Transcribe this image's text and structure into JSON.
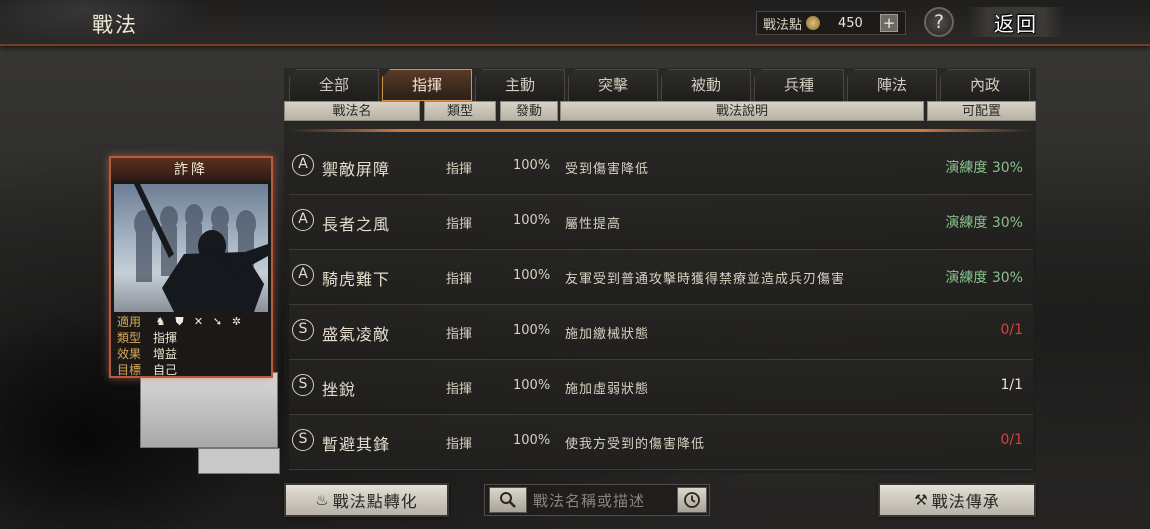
{
  "header": {
    "title": "戰法",
    "points_label": "戰法點",
    "points_value": "450",
    "add_label": "+",
    "help_label": "?",
    "back_label": "返回"
  },
  "tabs": [
    {
      "label": "全部",
      "active": false
    },
    {
      "label": "指揮",
      "active": true
    },
    {
      "label": "主動",
      "active": false
    },
    {
      "label": "突擊",
      "active": false
    },
    {
      "label": "被動",
      "active": false
    },
    {
      "label": "兵種",
      "active": false
    },
    {
      "label": "陣法",
      "active": false
    },
    {
      "label": "內政",
      "active": false
    }
  ],
  "columns": {
    "name": "戰法名",
    "type": "類型",
    "rate": "發動",
    "desc": "戰法說明",
    "config": "可配置"
  },
  "rows": [
    {
      "grade": "A",
      "name": "禦敵屏障",
      "type": "指揮",
      "rate": "100%",
      "desc": "受到傷害降低",
      "config": "演練度 30%",
      "config_status": "green"
    },
    {
      "grade": "A",
      "name": "長者之風",
      "type": "指揮",
      "rate": "100%",
      "desc": "屬性提高",
      "config": "演練度 30%",
      "config_status": "green"
    },
    {
      "grade": "A",
      "name": "騎虎難下",
      "type": "指揮",
      "rate": "100%",
      "desc": "友軍受到普通攻擊時獲得禁療並造成兵刃傷害",
      "config": "演練度 30%",
      "config_status": "green"
    },
    {
      "grade": "S",
      "name": "盛氣凌敵",
      "type": "指揮",
      "rate": "100%",
      "desc": "施加繳械狀態",
      "config": "0/1",
      "config_status": "red"
    },
    {
      "grade": "S",
      "name": "挫銳",
      "type": "指揮",
      "rate": "100%",
      "desc": "施加虛弱狀態",
      "config": "1/1",
      "config_status": "white"
    },
    {
      "grade": "S",
      "name": "暫避其鋒",
      "type": "指揮",
      "rate": "100%",
      "desc": "使我方受到的傷害降低",
      "config": "0/1",
      "config_status": "red"
    }
  ],
  "card": {
    "title": "詐降",
    "applies_label": "適用",
    "type_label": "類型",
    "type_value": "指揮",
    "effect_label": "效果",
    "effect_value": "增益",
    "target_label": "目標",
    "target_value": "自己",
    "unit_icons": [
      "cavalry-icon",
      "shield-icon",
      "bow-icon",
      "spear-icon",
      "siege-icon"
    ]
  },
  "footer": {
    "convert_label": "戰法點轉化",
    "search_placeholder": "戰法名稱或描述",
    "inherit_label": "戰法傳承"
  },
  "colors": {
    "accent": "#d79248",
    "config_green": "#88c28a",
    "config_red": "#d4423a",
    "card_border": "#b85a3c"
  }
}
